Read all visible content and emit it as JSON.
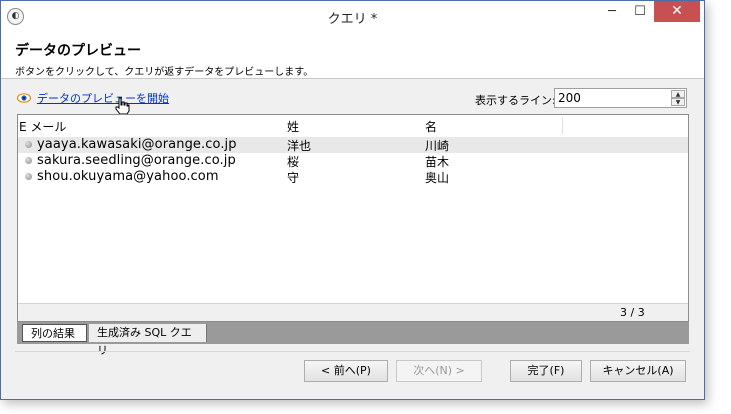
{
  "window": {
    "title": "クエリ *",
    "app_icon": "app-icon",
    "minimize": "─",
    "maximize": "☐",
    "close": "✕"
  },
  "header": {
    "title": "データのプレビュー",
    "subtitle": "ボタンをクリックして、クエリが返すデータをプレビューします。"
  },
  "preview": {
    "link_label": "データのプレビューを開始",
    "icon": "eye-icon"
  },
  "lines": {
    "label": "表示するライン:",
    "value": "200",
    "up": "▲",
    "down": "▼"
  },
  "table": {
    "columns": [
      "E メール",
      "姓",
      "名"
    ],
    "rows": [
      {
        "email": "yaaya.kawasaki@orange.co.jp",
        "first": "洋也",
        "last": "川崎"
      },
      {
        "email": "sakura.seedling@orange.co.jp",
        "first": "桜",
        "last": "苗木"
      },
      {
        "email": "shou.okuyama@yahoo.com",
        "first": "守",
        "last": "奥山"
      }
    ],
    "count": "3 / 3"
  },
  "tabs": [
    "列の結果",
    "生成済み SQL クエリ"
  ],
  "buttons": {
    "back": "< 前へ(P)",
    "next": "次へ(N) >",
    "finish": "完了(F)",
    "cancel": "キャンセル(A)"
  },
  "colors": {
    "link": "#0033cc",
    "close_button": "#c75050",
    "tab_bar": "#9a9a9a",
    "window_border": "#4a6ea8"
  }
}
